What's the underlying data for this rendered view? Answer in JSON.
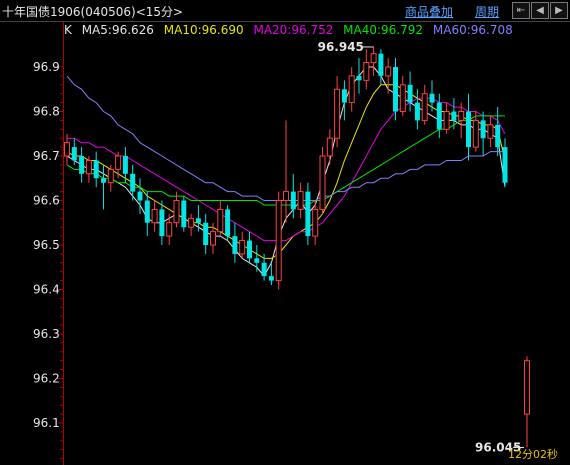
{
  "window": {
    "title": "十年国债1906(040506)<15分>",
    "menu_overlay": "商品叠加",
    "menu_period": "周期",
    "nav_icons": [
      "first-icon",
      "left-arrow-icon",
      "right-arrow-icon"
    ]
  },
  "legend": {
    "k_label": "K",
    "ma5": "MA5:96.626",
    "ma10": "MA10:96.690",
    "ma20": "MA20:96.752",
    "ma40": "MA40:96.792",
    "ma60": "MA60:96.708"
  },
  "colors": {
    "up": "#ff4040",
    "down": "#00e5e5",
    "ma5": "#e6e6e6",
    "ma10": "#e6e600",
    "ma20": "#e600e6",
    "ma40": "#00e600",
    "ma60": "#8080ff",
    "axis": "#b00000",
    "label": "#e6e6e6"
  },
  "chart_data": {
    "type": "candlestick",
    "ylim": [
      96.02,
      96.98
    ],
    "yticks": [
      "96.9",
      "96.8",
      "96.7",
      "96.6",
      "96.5",
      "96.4",
      "96.3",
      "96.2",
      "96.1"
    ],
    "annotations": {
      "high_label": "96.945",
      "low_label": "96.045",
      "countdown": "12分02秒"
    },
    "candles": [
      {
        "o": 96.7,
        "h": 96.75,
        "l": 96.68,
        "c": 96.73
      },
      {
        "o": 96.72,
        "h": 96.74,
        "l": 96.68,
        "c": 96.69
      },
      {
        "o": 96.7,
        "h": 96.72,
        "l": 96.64,
        "c": 96.66
      },
      {
        "o": 96.66,
        "h": 96.7,
        "l": 96.64,
        "c": 96.69
      },
      {
        "o": 96.69,
        "h": 96.71,
        "l": 96.63,
        "c": 96.65
      },
      {
        "o": 96.65,
        "h": 96.68,
        "l": 96.58,
        "c": 96.64
      },
      {
        "o": 96.64,
        "h": 96.68,
        "l": 96.62,
        "c": 96.67
      },
      {
        "o": 96.67,
        "h": 96.71,
        "l": 96.65,
        "c": 96.7
      },
      {
        "o": 96.7,
        "h": 96.72,
        "l": 96.64,
        "c": 96.66
      },
      {
        "o": 96.66,
        "h": 96.68,
        "l": 96.6,
        "c": 96.62
      },
      {
        "o": 96.62,
        "h": 96.65,
        "l": 96.57,
        "c": 96.6
      },
      {
        "o": 96.6,
        "h": 96.62,
        "l": 96.52,
        "c": 96.55
      },
      {
        "o": 96.55,
        "h": 96.6,
        "l": 96.53,
        "c": 96.58
      },
      {
        "o": 96.58,
        "h": 96.6,
        "l": 96.5,
        "c": 96.52
      },
      {
        "o": 96.52,
        "h": 96.57,
        "l": 96.5,
        "c": 96.55
      },
      {
        "o": 96.55,
        "h": 96.62,
        "l": 96.54,
        "c": 96.6
      },
      {
        "o": 96.6,
        "h": 96.61,
        "l": 96.53,
        "c": 96.54
      },
      {
        "o": 96.54,
        "h": 96.57,
        "l": 96.52,
        "c": 96.56
      },
      {
        "o": 96.56,
        "h": 96.59,
        "l": 96.53,
        "c": 96.55
      },
      {
        "o": 96.55,
        "h": 96.57,
        "l": 96.48,
        "c": 96.5
      },
      {
        "o": 96.5,
        "h": 96.55,
        "l": 96.48,
        "c": 96.53
      },
      {
        "o": 96.53,
        "h": 96.6,
        "l": 96.52,
        "c": 96.58
      },
      {
        "o": 96.58,
        "h": 96.59,
        "l": 96.51,
        "c": 96.52
      },
      {
        "o": 96.52,
        "h": 96.55,
        "l": 96.46,
        "c": 96.48
      },
      {
        "o": 96.48,
        "h": 96.53,
        "l": 96.47,
        "c": 96.51
      },
      {
        "o": 96.51,
        "h": 96.53,
        "l": 96.46,
        "c": 96.47
      },
      {
        "o": 96.47,
        "h": 96.5,
        "l": 96.44,
        "c": 96.46
      },
      {
        "o": 96.46,
        "h": 96.48,
        "l": 96.42,
        "c": 96.43
      },
      {
        "o": 96.43,
        "h": 96.46,
        "l": 96.41,
        "c": 96.42
      },
      {
        "o": 96.42,
        "h": 96.62,
        "l": 96.4,
        "c": 96.6
      },
      {
        "o": 96.6,
        "h": 96.78,
        "l": 96.55,
        "c": 96.62
      },
      {
        "o": 96.62,
        "h": 96.66,
        "l": 96.56,
        "c": 96.58
      },
      {
        "o": 96.58,
        "h": 96.64,
        "l": 96.56,
        "c": 96.62
      },
      {
        "o": 96.62,
        "h": 96.64,
        "l": 96.5,
        "c": 96.52
      },
      {
        "o": 96.52,
        "h": 96.6,
        "l": 96.5,
        "c": 96.58
      },
      {
        "o": 96.58,
        "h": 96.72,
        "l": 96.57,
        "c": 96.7
      },
      {
        "o": 96.7,
        "h": 96.76,
        "l": 96.68,
        "c": 96.74
      },
      {
        "o": 96.74,
        "h": 96.88,
        "l": 96.72,
        "c": 96.85
      },
      {
        "o": 96.85,
        "h": 96.87,
        "l": 96.78,
        "c": 96.82
      },
      {
        "o": 96.82,
        "h": 96.9,
        "l": 96.8,
        "c": 96.88
      },
      {
        "o": 96.88,
        "h": 96.92,
        "l": 96.84,
        "c": 96.87
      },
      {
        "o": 96.87,
        "h": 96.94,
        "l": 96.85,
        "c": 96.91
      },
      {
        "o": 96.91,
        "h": 96.945,
        "l": 96.88,
        "c": 96.93
      },
      {
        "o": 96.93,
        "h": 96.94,
        "l": 96.86,
        "c": 96.88
      },
      {
        "o": 96.88,
        "h": 96.92,
        "l": 96.84,
        "c": 96.9
      },
      {
        "o": 96.9,
        "h": 96.92,
        "l": 96.78,
        "c": 96.8
      },
      {
        "o": 96.8,
        "h": 96.88,
        "l": 96.79,
        "c": 96.86
      },
      {
        "o": 96.86,
        "h": 96.89,
        "l": 96.8,
        "c": 96.82
      },
      {
        "o": 96.82,
        "h": 96.85,
        "l": 96.76,
        "c": 96.78
      },
      {
        "o": 96.78,
        "h": 96.86,
        "l": 96.77,
        "c": 96.84
      },
      {
        "o": 96.84,
        "h": 96.87,
        "l": 96.8,
        "c": 96.82
      },
      {
        "o": 96.82,
        "h": 96.84,
        "l": 96.74,
        "c": 96.76
      },
      {
        "o": 96.76,
        "h": 96.82,
        "l": 96.75,
        "c": 96.8
      },
      {
        "o": 96.8,
        "h": 96.83,
        "l": 96.76,
        "c": 96.78
      },
      {
        "o": 96.78,
        "h": 96.82,
        "l": 96.74,
        "c": 96.8
      },
      {
        "o": 96.8,
        "h": 96.84,
        "l": 96.69,
        "c": 96.72
      },
      {
        "o": 96.72,
        "h": 96.8,
        "l": 96.71,
        "c": 96.78
      },
      {
        "o": 96.78,
        "h": 96.8,
        "l": 96.7,
        "c": 96.74
      },
      {
        "o": 96.74,
        "h": 96.79,
        "l": 96.72,
        "c": 96.77
      },
      {
        "o": 96.77,
        "h": 96.81,
        "l": 96.7,
        "c": 96.72
      },
      {
        "o": 96.72,
        "h": 96.74,
        "l": 96.63,
        "c": 96.64
      },
      {
        "o": 96.12,
        "h": 96.25,
        "l": 96.045,
        "c": 96.24
      }
    ],
    "ma_series": [
      {
        "name": "MA5",
        "y": [
          96.7,
          96.69,
          96.68,
          96.67,
          96.67,
          96.66,
          96.65,
          96.64,
          96.63,
          96.61,
          96.59,
          96.56,
          96.55,
          96.55,
          96.56,
          96.57,
          96.56,
          96.55,
          96.54,
          96.53,
          96.52,
          96.52,
          96.51,
          96.49,
          96.47,
          96.46,
          96.45,
          96.43,
          96.46,
          96.52,
          96.56,
          96.58,
          96.6,
          96.57,
          96.59,
          96.64,
          96.69,
          96.76,
          96.82,
          96.86,
          96.88,
          96.9,
          96.9,
          96.88,
          96.85,
          96.84,
          96.83,
          96.82,
          96.81,
          96.8,
          96.79,
          96.78,
          96.78,
          96.78,
          96.77,
          96.77,
          96.76,
          96.76,
          96.75,
          96.74,
          96.63
        ]
      },
      {
        "name": "MA10",
        "y": [
          96.71,
          96.7,
          96.7,
          96.69,
          96.69,
          96.68,
          96.67,
          96.66,
          96.65,
          96.64,
          96.63,
          96.61,
          96.6,
          96.59,
          96.58,
          96.57,
          96.56,
          96.55,
          96.55,
          96.54,
          96.54,
          96.53,
          96.52,
          96.51,
          96.5,
          96.49,
          96.48,
          96.47,
          96.47,
          96.48,
          96.5,
          96.52,
          96.53,
          96.54,
          96.55,
          96.57,
          96.6,
          96.64,
          96.69,
          96.73,
          96.77,
          96.81,
          96.84,
          96.86,
          96.86,
          96.86,
          96.85,
          96.84,
          96.83,
          96.82,
          96.81,
          96.8,
          96.8,
          96.79,
          96.79,
          96.78,
          96.78,
          96.77,
          96.77,
          96.76,
          96.69
        ]
      },
      {
        "name": "MA20",
        "y": [
          96.74,
          96.74,
          96.73,
          96.73,
          96.72,
          96.72,
          96.71,
          96.7,
          96.7,
          96.69,
          96.68,
          96.67,
          96.66,
          96.65,
          96.64,
          96.63,
          96.62,
          96.61,
          96.6,
          96.59,
          96.58,
          96.57,
          96.56,
          96.55,
          96.54,
          96.53,
          96.52,
          96.51,
          96.51,
          96.51,
          96.51,
          96.52,
          96.53,
          96.53,
          96.54,
          96.55,
          96.57,
          96.59,
          96.61,
          96.64,
          96.67,
          96.7,
          96.73,
          96.76,
          96.78,
          96.8,
          96.81,
          96.82,
          96.83,
          96.83,
          96.83,
          96.82,
          96.82,
          96.81,
          96.81,
          96.8,
          96.8,
          96.79,
          96.79,
          96.78,
          96.75
        ]
      },
      {
        "name": "MA40",
        "y": [
          96.68,
          96.67,
          96.67,
          96.66,
          96.66,
          96.65,
          96.65,
          96.64,
          96.64,
          96.63,
          96.63,
          96.62,
          96.62,
          96.62,
          96.61,
          96.61,
          96.61,
          96.6,
          96.6,
          96.6,
          96.6,
          96.6,
          96.6,
          96.6,
          96.6,
          96.6,
          96.6,
          96.59,
          96.59,
          96.59,
          96.59,
          96.59,
          96.59,
          96.59,
          96.6,
          96.6,
          96.61,
          96.62,
          96.63,
          96.64,
          96.65,
          96.66,
          96.67,
          96.68,
          96.69,
          96.7,
          96.71,
          96.72,
          96.73,
          96.74,
          96.75,
          96.76,
          96.76,
          96.77,
          96.78,
          96.78,
          96.79,
          96.79,
          96.79,
          96.79,
          96.79
        ]
      },
      {
        "name": "MA60",
        "y": [
          96.88,
          96.86,
          96.85,
          96.83,
          96.82,
          96.8,
          96.79,
          96.77,
          96.76,
          96.75,
          96.73,
          96.72,
          96.71,
          96.7,
          96.69,
          96.68,
          96.67,
          96.66,
          96.65,
          96.64,
          96.64,
          96.63,
          96.62,
          96.62,
          96.61,
          96.61,
          96.61,
          96.6,
          96.6,
          96.6,
          96.6,
          96.6,
          96.6,
          96.6,
          96.6,
          96.61,
          96.61,
          96.62,
          96.62,
          96.63,
          96.63,
          96.64,
          96.64,
          96.65,
          96.65,
          96.66,
          96.66,
          96.67,
          96.67,
          96.68,
          96.68,
          96.68,
          96.69,
          96.69,
          96.69,
          96.7,
          96.7,
          96.7,
          96.71,
          96.71,
          96.71
        ]
      }
    ]
  }
}
